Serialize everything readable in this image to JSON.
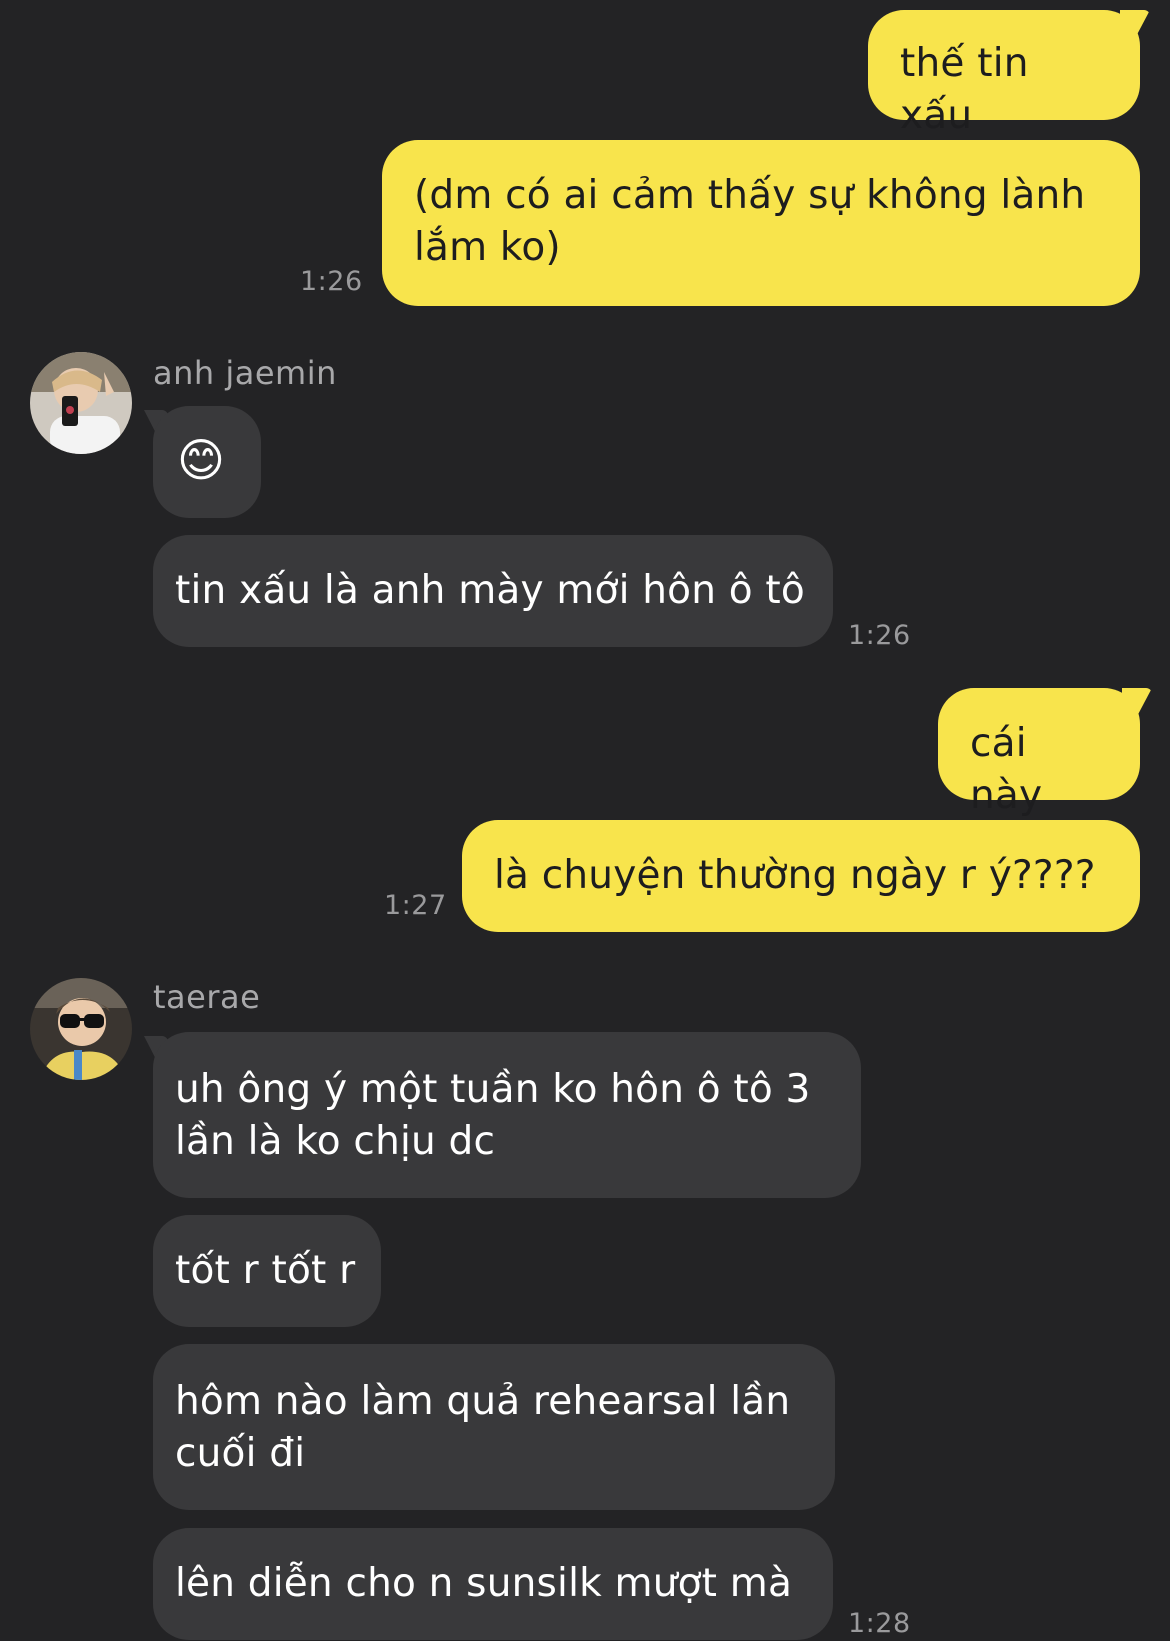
{
  "colors": {
    "background": "#232325",
    "my_bubble": "#f8e44c",
    "their_bubble": "#39393b",
    "timestamp": "#9a9a9c"
  },
  "messages": {
    "m1": {
      "text": "thế tin xấu"
    },
    "m2": {
      "text": "(dm có ai cảm thấy sự không lành lắm ko)",
      "time": "1:26"
    },
    "sender1": {
      "name": "anh jaemin",
      "avatar_icon": "avatar-photo-jaemin"
    },
    "m3": {
      "text": "😊"
    },
    "m4": {
      "text": "tin xấu là anh mày mới hôn ô tô",
      "time": "1:26"
    },
    "m5": {
      "text": "cái này"
    },
    "m6": {
      "text": "là chuyện thường ngày r ý????",
      "time": "1:27"
    },
    "sender2": {
      "name": "taerae",
      "avatar_icon": "avatar-photo-taerae"
    },
    "m7": {
      "text": "uh ông ý một tuần ko hôn ô tô 3 lần là ko chịu dc"
    },
    "m8": {
      "text": "tốt r tốt r"
    },
    "m9": {
      "text": "hôm nào làm quả rehearsal lần cuối đi"
    },
    "m10": {
      "text": "lên diễn cho n sunsilk mượt mà",
      "time": "1:28"
    }
  }
}
